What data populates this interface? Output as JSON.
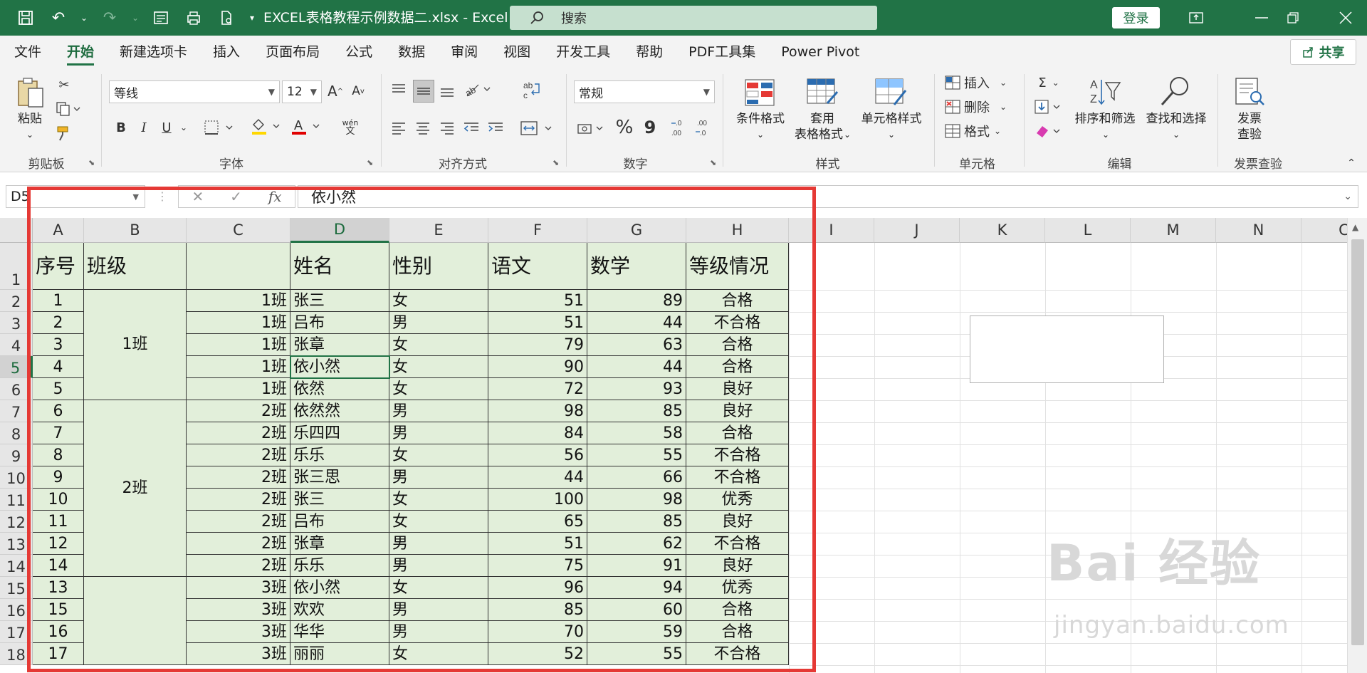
{
  "titlebar": {
    "doc_title": "EXCEL表格教程示例数据二.xlsx  -  Excel",
    "search_placeholder": "搜索",
    "login_label": "登录"
  },
  "tabs": [
    "文件",
    "开始",
    "新建选项卡",
    "插入",
    "页面布局",
    "公式",
    "数据",
    "审阅",
    "视图",
    "开发工具",
    "帮助",
    "PDF工具集",
    "Power Pivot"
  ],
  "active_tab": "开始",
  "share_label": "共享",
  "ribbon": {
    "clipboard": {
      "paste": "粘贴",
      "label": "剪贴板"
    },
    "font": {
      "name": "等线",
      "size": "12",
      "label": "字体",
      "bold": "B",
      "italic": "I",
      "underline": "U",
      "grow": "A",
      "shrink": "A",
      "wen": "wén",
      "wen_sub": "文"
    },
    "alignment": {
      "label": "对齐方式"
    },
    "number": {
      "format": "常规",
      "label": "数字",
      "percent": "%",
      "comma": "9"
    },
    "styles": {
      "cond_format": "条件格式",
      "table_format_1": "套用",
      "table_format_2": "表格格式",
      "cell_style": "单元格样式",
      "label": "样式"
    },
    "cells": {
      "insert": "插入",
      "delete": "删除",
      "format": "格式",
      "label": "单元格"
    },
    "editing": {
      "sort": "排序和筛选",
      "find": "查找和选择",
      "label": "编辑"
    },
    "invoice": {
      "line1": "发票",
      "line2": "查验",
      "label": "发票查验"
    }
  },
  "formula_bar": {
    "name_box": "D5",
    "fx": "fx",
    "content": "依小然"
  },
  "columns": [
    "A",
    "B",
    "C",
    "D",
    "E",
    "F",
    "G",
    "H",
    "I",
    "J",
    "K",
    "L",
    "M",
    "N",
    "C"
  ],
  "selected_column": "D",
  "row_numbers": [
    "1",
    "2",
    "3",
    "4",
    "5",
    "6",
    "7",
    "8",
    "9",
    "10",
    "11",
    "12",
    "13",
    "14",
    "15",
    "16",
    "17",
    "18"
  ],
  "selected_row": "5",
  "table": {
    "headers": {
      "A": "序号",
      "B": "班级",
      "C": "",
      "D": "姓名",
      "E": "性别",
      "F": "语文",
      "G": "数学",
      "H": "等级情况"
    },
    "merged_classes": [
      "1班",
      "2班",
      ""
    ],
    "rows": [
      [
        "1",
        "1班",
        "张三",
        "女",
        "51",
        "89",
        "合格"
      ],
      [
        "2",
        "1班",
        "吕布",
        "男",
        "51",
        "44",
        "不合格"
      ],
      [
        "3",
        "1班",
        "张章",
        "女",
        "79",
        "63",
        "合格"
      ],
      [
        "4",
        "1班",
        "依小然",
        "女",
        "90",
        "44",
        "合格"
      ],
      [
        "5",
        "1班",
        "依然",
        "女",
        "72",
        "93",
        "良好"
      ],
      [
        "6",
        "2班",
        "依然然",
        "男",
        "98",
        "85",
        "良好"
      ],
      [
        "7",
        "2班",
        "乐四四",
        "男",
        "84",
        "58",
        "合格"
      ],
      [
        "8",
        "2班",
        "乐乐",
        "女",
        "56",
        "55",
        "不合格"
      ],
      [
        "9",
        "2班",
        "张三思",
        "男",
        "44",
        "66",
        "不合格"
      ],
      [
        "10",
        "2班",
        "张三",
        "女",
        "100",
        "98",
        "优秀"
      ],
      [
        "11",
        "2班",
        "吕布",
        "女",
        "65",
        "85",
        "良好"
      ],
      [
        "12",
        "2班",
        "张章",
        "男",
        "51",
        "62",
        "不合格"
      ],
      [
        "14",
        "2班",
        "乐乐",
        "男",
        "75",
        "91",
        "良好"
      ],
      [
        "13",
        "3班",
        "依小然",
        "女",
        "96",
        "94",
        "优秀"
      ],
      [
        "15",
        "3班",
        "欢欢",
        "男",
        "85",
        "60",
        "合格"
      ],
      [
        "16",
        "3班",
        "华华",
        "男",
        "70",
        "59",
        "合格"
      ],
      [
        "17",
        "3班",
        "丽丽",
        "女",
        "52",
        "55",
        "不合格"
      ]
    ]
  },
  "watermark": {
    "line1": "Bai 经验",
    "line2": "jingyan.baidu.com"
  },
  "colors": {
    "accent": "#217346",
    "cell_fill": "#e2efda",
    "highlight_border": "#e53935"
  }
}
